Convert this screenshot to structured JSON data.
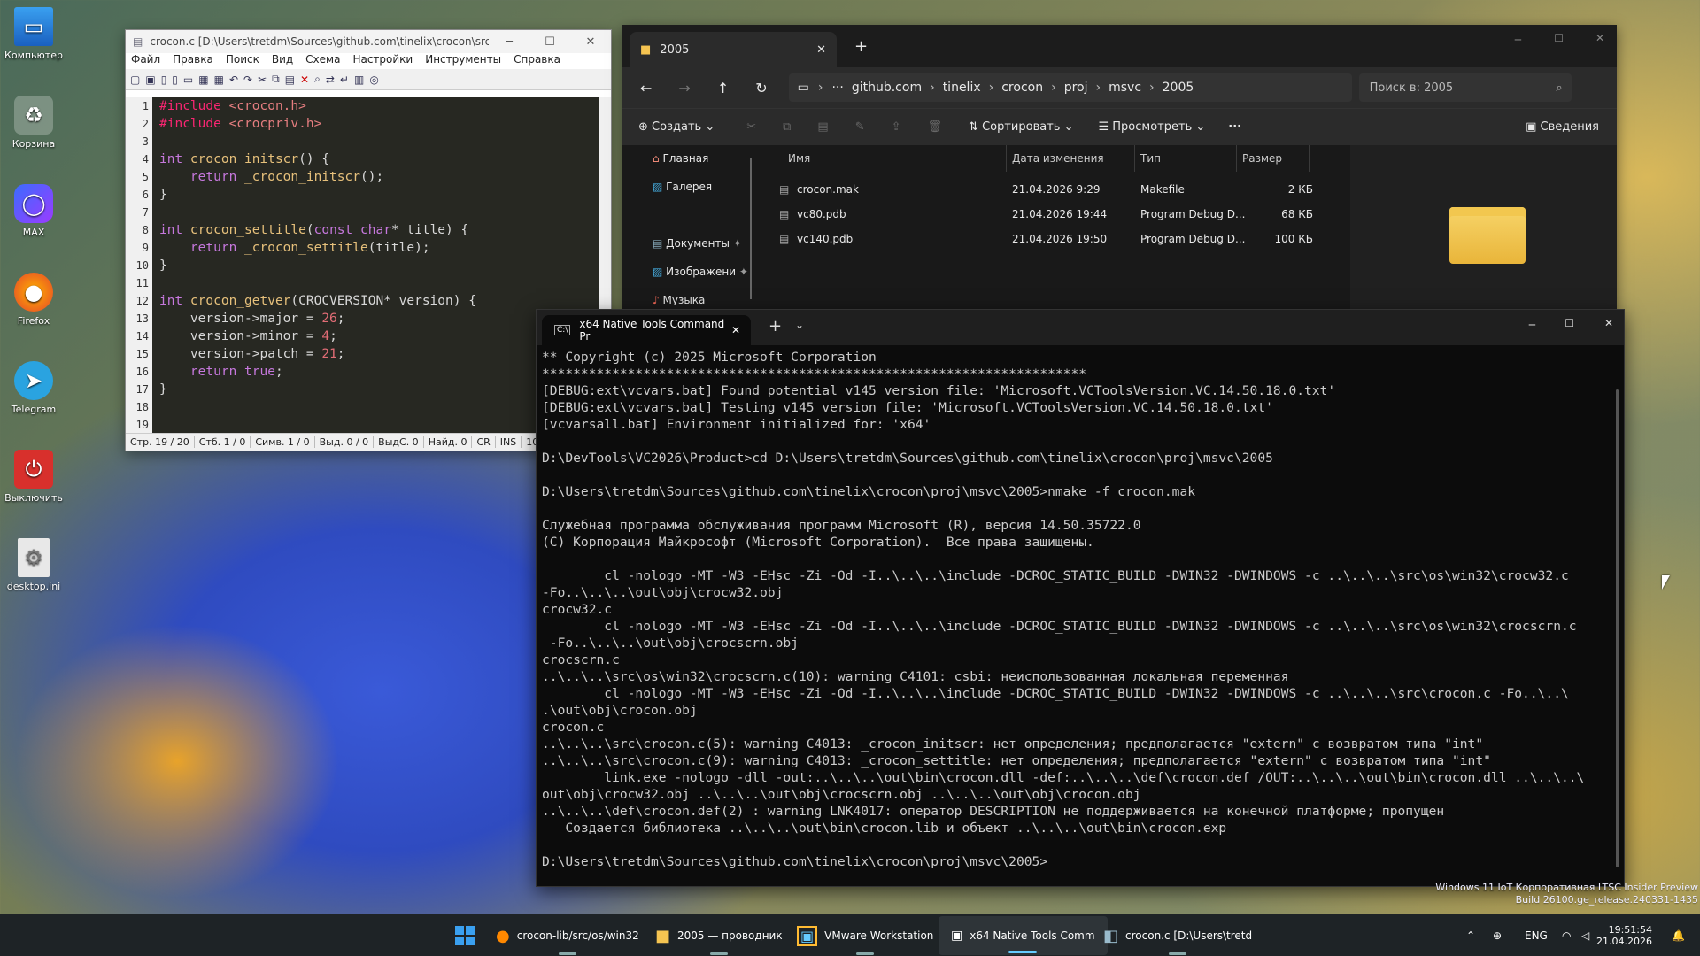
{
  "desktop": {
    "icons": [
      {
        "label": "Компьютер"
      },
      {
        "label": "Корзина"
      },
      {
        "label": "MAX"
      },
      {
        "label": "Firefox"
      },
      {
        "label": "Telegram"
      },
      {
        "label": "Выключить"
      },
      {
        "label": "desktop.ini"
      }
    ],
    "watermark_line1": "Windows 11 IoT Корпоративная LTSC Insider Preview",
    "watermark_line2": "Build 26100.ge_release.240331-1435"
  },
  "notepad": {
    "title": "crocon.c [D:\\Users\\tretdm\\Sources\\github.com\\tinelix\\crocon\\src] - No...",
    "menu": [
      "Файл",
      "Правка",
      "Поиск",
      "Вид",
      "Схема",
      "Настройки",
      "Инструменты",
      "Справка"
    ],
    "line_numbers": [
      "1",
      "2",
      "3",
      "4",
      "5",
      "6",
      "7",
      "8",
      "9",
      "10",
      "11",
      "12",
      "13",
      "14",
      "15",
      "16",
      "17",
      "18",
      "19"
    ],
    "code": {
      "l1a": "#include ",
      "l1b": "<crocon.h>",
      "l2a": "#include ",
      "l2b": "<crocpriv.h>",
      "l4a": "int ",
      "l4b": "crocon_initscr",
      "l4c": "() {",
      "l5a": "return ",
      "l5b": "_crocon_initscr",
      "l5c": "();",
      "l6": "}",
      "l8a": "int ",
      "l8b": "crocon_settitle",
      "l8c": "(",
      "l8d": "const ",
      "l8e": "char",
      "l8f": "* title) {",
      "l9a": "return ",
      "l9b": "_crocon_settitle",
      "l9c": "(title);",
      "l10": "}",
      "l12a": "int ",
      "l12b": "crocon_getver",
      "l12c": "(CROCVERSION* version) {",
      "l13a": "version->major = ",
      "l13b": "26",
      "l13c": ";",
      "l14a": "version->minor = ",
      "l14b": "4",
      "l14c": ";",
      "l15a": "version->patch = ",
      "l15b": "21",
      "l15c": ";",
      "l16a": "return ",
      "l16b": "true",
      "l16c": ";",
      "l17": "}"
    },
    "status": [
      "Стр. 19 / 20",
      "Стб. 1 / 0",
      "Симв. 1 / 0",
      "Выд. 0 / 0",
      "ВыдС. 0",
      "Найд. 0",
      "CR",
      "INS",
      "10"
    ]
  },
  "explorer": {
    "tab_title": "2005",
    "breadcrumbs": [
      "github.com",
      "tinelix",
      "crocon",
      "proj",
      "msvc",
      "2005"
    ],
    "search_placeholder": "Поиск в: 2005",
    "cmd": {
      "create": "Создать",
      "sort": "Сортировать",
      "view": "Просмотреть",
      "details": "Сведения"
    },
    "nav": [
      "Главная",
      "Галерея",
      "Документы",
      "Изображени",
      "Музыка"
    ],
    "columns": [
      "Имя",
      "Дата изменения",
      "Тип",
      "Размер"
    ],
    "files": [
      {
        "name": "crocon.mak",
        "date": "21.04.2026 9:29",
        "type": "Makefile",
        "size": "2 КБ"
      },
      {
        "name": "vc80.pdb",
        "date": "21.04.2026 19:44",
        "type": "Program Debug D...",
        "size": "68 КБ"
      },
      {
        "name": "vc140.pdb",
        "date": "21.04.2026 19:50",
        "type": "Program Debug D...",
        "size": "100 КБ"
      }
    ]
  },
  "terminal": {
    "tab_title": "x64 Native Tools Command Pr",
    "lines": [
      "** Copyright (c) 2025 Microsoft Corporation",
      "**********************************************************************",
      "[DEBUG:ext\\vcvars.bat] Found potential v145 version file: 'Microsoft.VCToolsVersion.VC.14.50.18.0.txt'",
      "[DEBUG:ext\\vcvars.bat] Testing v145 version file: 'Microsoft.VCToolsVersion.VC.14.50.18.0.txt'",
      "[vcvarsall.bat] Environment initialized for: 'x64'",
      "",
      "D:\\DevTools\\VC2026\\Product>cd D:\\Users\\tretdm\\Sources\\github.com\\tinelix\\crocon\\proj\\msvc\\2005",
      "",
      "D:\\Users\\tretdm\\Sources\\github.com\\tinelix\\crocon\\proj\\msvc\\2005>nmake -f crocon.mak",
      "",
      "Служебная программа обслуживания программ Microsoft (R), версия 14.50.35722.0",
      "(C) Корпорация Майкрософт (Microsoft Corporation).  Все права защищены.",
      "",
      "        cl -nologo -MT -W3 -EHsc -Zi -Od -I..\\..\\..\\include -DCROC_STATIC_BUILD -DWIN32 -DWINDOWS -c ..\\..\\..\\src\\os\\win32\\crocw32.c",
      "-Fo..\\..\\..\\out\\obj\\crocw32.obj",
      "crocw32.c",
      "        cl -nologo -MT -W3 -EHsc -Zi -Od -I..\\..\\..\\include -DCROC_STATIC_BUILD -DWIN32 -DWINDOWS -c ..\\..\\..\\src\\os\\win32\\crocscrn.c",
      " -Fo..\\..\\..\\out\\obj\\crocscrn.obj",
      "crocscrn.c",
      "..\\..\\..\\src\\os\\win32\\crocscrn.c(10): warning C4101: csbi: неиспользованная локальная переменная",
      "        cl -nologo -MT -W3 -EHsc -Zi -Od -I..\\..\\..\\include -DCROC_STATIC_BUILD -DWIN32 -DWINDOWS -c ..\\..\\..\\src\\crocon.c -Fo..\\..\\",
      ".\\out\\obj\\crocon.obj",
      "crocon.c",
      "..\\..\\..\\src\\crocon.c(5): warning C4013: _crocon_initscr: нет определения; предполагается \"extern\" с возвратом типа \"int\"",
      "..\\..\\..\\src\\crocon.c(9): warning C4013: _crocon_settitle: нет определения; предполагается \"extern\" с возвратом типа \"int\"",
      "        link.exe -nologo -dll -out:..\\..\\..\\out\\bin\\crocon.dll -def:..\\..\\..\\def\\crocon.def /OUT:..\\..\\..\\out\\bin\\crocon.dll ..\\..\\..\\",
      "out\\obj\\crocw32.obj ..\\..\\..\\out\\obj\\crocscrn.obj ..\\..\\..\\out\\obj\\crocon.obj",
      "..\\..\\..\\def\\crocon.def(2) : warning LNK4017: оператор DESCRIPTION не поддерживается на конечной платформе; пропущен",
      "   Создается библиотека ..\\..\\..\\out\\bin\\crocon.lib и объект ..\\..\\..\\out\\bin\\crocon.exp",
      "",
      "D:\\Users\\tretdm\\Sources\\github.com\\tinelix\\crocon\\proj\\msvc\\2005>"
    ]
  },
  "taskbar": {
    "items": [
      "crocon-lib/src/os/win32",
      "2005 — проводник",
      "VMware Workstation",
      "x64 Native Tools Comm",
      "crocon.c [D:\\Users\\tretd"
    ],
    "lang": "ENG",
    "time": "19:51:54",
    "date": "21.04.2026"
  }
}
